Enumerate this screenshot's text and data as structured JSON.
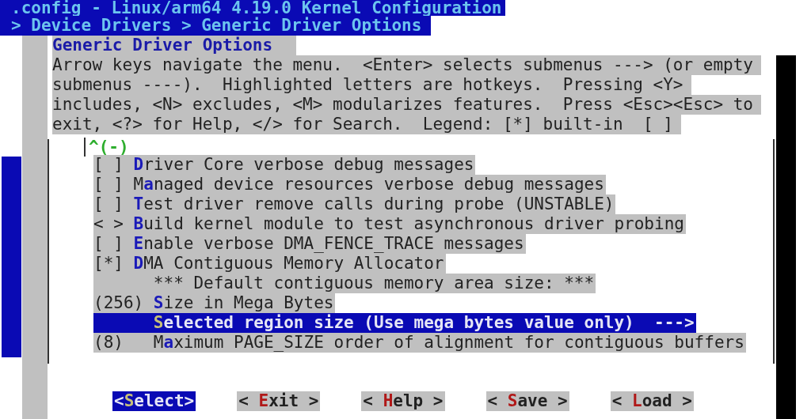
{
  "window": {
    "title": ".config - Linux/arm64 4.19.0 Kernel Configuration"
  },
  "breadcrumb": "> Device Drivers > Generic Driver Options",
  "dialog": {
    "title": "Generic Driver Options",
    "help_lines": [
      "Arrow keys navigate the menu.  <Enter> selects submenus ---> (or empty",
      "submenus ----).  Highlighted letters are hotkeys.  Pressing <Y>",
      "includes, <N> excludes, <M> modularizes features.  Press <Esc><Esc> to",
      "exit, <?> for Help, </> for Search.  Legend: [*] built-in  [ ]"
    ],
    "scroll_indicator": "^(-)",
    "items": [
      {
        "kind": "bool",
        "value": "[ ]",
        "hotkey": "D",
        "after": "river Core verbose debug messages",
        "selected": false
      },
      {
        "kind": "bool",
        "value": "[ ]",
        "before": "M",
        "hotkey": "a",
        "after": "naged device resources verbose debug messages",
        "selected": false
      },
      {
        "kind": "bool",
        "value": "[ ]",
        "hotkey": "T",
        "after": "est driver remove calls during probe (UNSTABLE)",
        "selected": false
      },
      {
        "kind": "tristate",
        "value": "< >",
        "hotkey": "B",
        "after": "uild kernel module to test asynchronous driver probing",
        "selected": false
      },
      {
        "kind": "bool",
        "value": "[ ]",
        "hotkey": "E",
        "after": "nable verbose DMA_FENCE_TRACE messages",
        "selected": false
      },
      {
        "kind": "bool",
        "value": "[*]",
        "hotkey": "D",
        "after": "MA Contiguous Memory Allocator",
        "selected": false
      },
      {
        "kind": "comment",
        "before": "*** Default contiguous memory area size: ***",
        "selected": false
      },
      {
        "kind": "int",
        "value": "(256)",
        "hotkey": "S",
        "after": "ize in Mega Bytes",
        "selected": false
      },
      {
        "kind": "choice",
        "hotkey": "S",
        "after": "elected region size (Use mega bytes value only)  --->",
        "selected": true
      },
      {
        "kind": "int",
        "value": "(8)",
        "before": "M",
        "hotkey": "a",
        "after": "ximum PAGE_SIZE order of alignment for contiguous buffers",
        "selected": false
      }
    ]
  },
  "buttons": [
    {
      "before": "<",
      "hotkey": "S",
      "after": "elect>",
      "selected": true
    },
    {
      "before": "< ",
      "hotkey": "E",
      "after": "xit >",
      "selected": false
    },
    {
      "before": "< ",
      "hotkey": "H",
      "after": "elp >",
      "selected": false
    },
    {
      "before": "< ",
      "hotkey": "S",
      "after": "ave >",
      "selected": false
    },
    {
      "before": "< ",
      "hotkey": "L",
      "after": "oad >",
      "selected": false
    }
  ]
}
